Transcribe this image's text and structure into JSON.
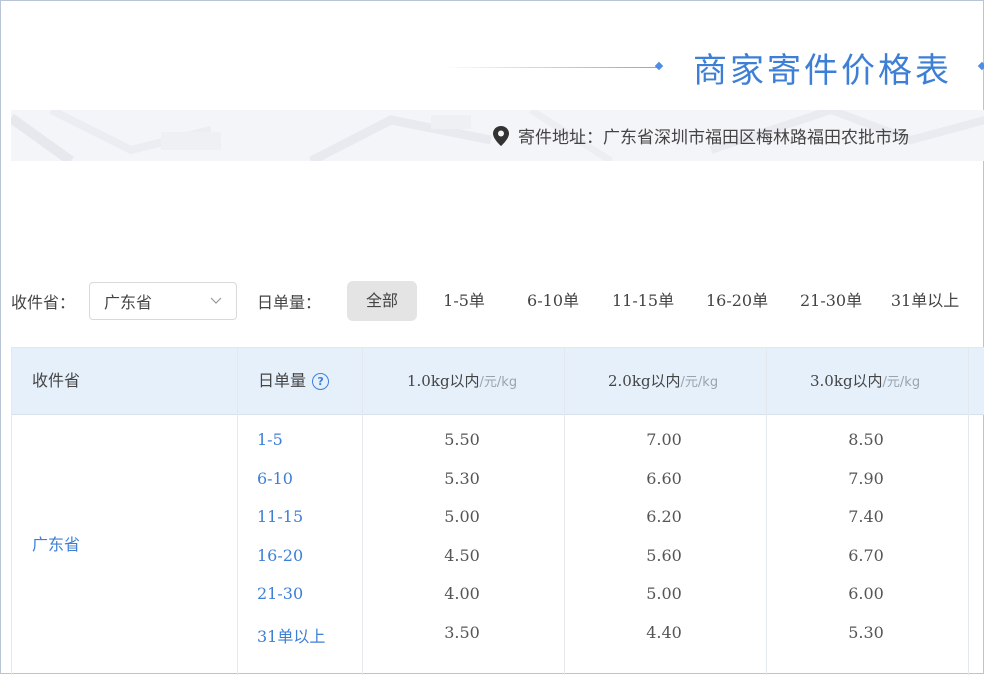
{
  "header": {
    "title": "商家寄件价格表"
  },
  "address": {
    "label": "寄件地址：",
    "value": "广东省深圳市福田区梅林路福田农批市场"
  },
  "filters": {
    "province_label": "收件省：",
    "province_value": "广东省",
    "daily_label": "日单量：",
    "chips": [
      "全部",
      "1-5单",
      "6-10单",
      "11-15单",
      "16-20单",
      "21-30单",
      "31单以上"
    ],
    "active_chip": "全部"
  },
  "table": {
    "headers": {
      "province": "收件省",
      "daily": "日单量",
      "help": "?",
      "w1": "1.0kg以内",
      "w2": "2.0kg以内",
      "w3": "3.0kg以内",
      "unit": "/元/kg"
    },
    "province": "广东省",
    "rows": [
      {
        "range": "1-5",
        "p1": "5.50",
        "p2": "7.00",
        "p3": "8.50"
      },
      {
        "range": "6-10",
        "p1": "5.30",
        "p2": "6.60",
        "p3": "7.90"
      },
      {
        "range": "11-15",
        "p1": "5.00",
        "p2": "6.20",
        "p3": "7.40"
      },
      {
        "range": "16-20",
        "p1": "4.50",
        "p2": "5.60",
        "p3": "6.70"
      },
      {
        "range": "21-30",
        "p1": "4.00",
        "p2": "5.00",
        "p3": "6.00"
      },
      {
        "range": "31单以上",
        "p1": "3.50",
        "p2": "4.40",
        "p3": "5.30"
      }
    ]
  },
  "colors": {
    "accent": "#3e7fd6",
    "header_bg": "#e6f0fb"
  }
}
